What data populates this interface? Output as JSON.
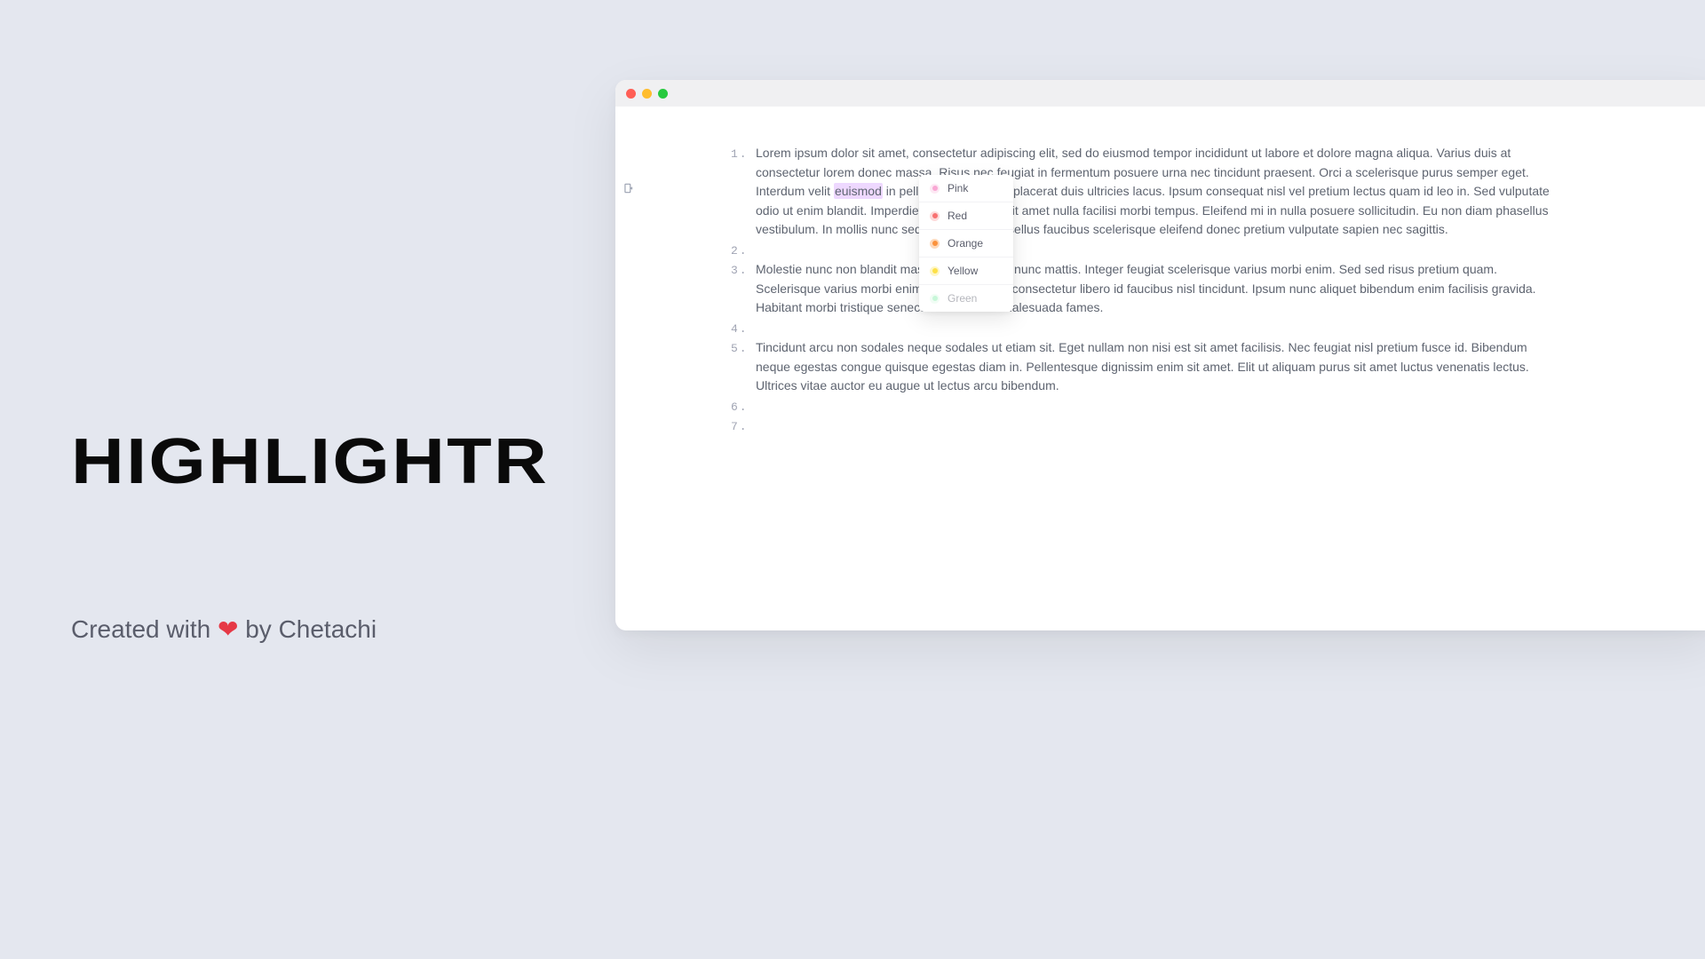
{
  "brand": "HIGHLIGHTR",
  "credit": {
    "prefix": "Created with ",
    "heart": "❤",
    "suffix": " by Chetachi"
  },
  "editor": {
    "highlighted_word": "euismod",
    "lines": [
      {
        "n": "1.",
        "before": "Lorem ipsum dolor sit amet, consectetur adipiscing elit, sed do eiusmod tempor incididunt ut labore et dolore magna aliqua. Varius duis at consectetur lorem donec massa. Risus nec feugiat in fermentum posuere urna nec tincidunt praesent. Orci a scelerisque purus semper eget. Interdum velit ",
        "hl": "euismod",
        "after": " in pellentesque massa placerat duis ultricies lacus. Ipsum consequat nisl vel pretium lectus quam id leo in. Sed vulputate odio ut enim blandit. Imperdiet dui accumsan sit amet nulla facilisi morbi tempus. Eleifend mi in nulla posuere sollicitudin. Eu non diam phasellus vestibulum. In mollis nunc sed id semper. Phasellus faucibus scelerisque eleifend donec pretium vulputate sapien nec sagittis."
      },
      {
        "n": "2.",
        "before": "",
        "hl": "",
        "after": ""
      },
      {
        "n": "3.",
        "before": "Molestie nunc non blandit massa enim nec dui nunc mattis. Integer feugiat scelerisque varius morbi enim. Sed sed risus pretium quam. Scelerisque varius morbi enim nunc. Interdum consectetur libero id faucibus nisl tincidunt. Ipsum nunc aliquet bibendum enim facilisis gravida. Habitant morbi tristique senectus et netus et malesuada fames.",
        "hl": "",
        "after": ""
      },
      {
        "n": "4.",
        "before": "",
        "hl": "",
        "after": ""
      },
      {
        "n": "5.",
        "before": "Tincidunt arcu non sodales neque sodales ut etiam sit. Eget nullam non nisi est sit amet facilisis. Nec feugiat nisl pretium fusce id. Bibendum neque egestas congue quisque egestas diam in. Pellentesque dignissim enim sit amet. Elit ut aliquam purus sit amet luctus venenatis lectus. Ultrices vitae auctor eu augue ut lectus arcu bibendum.",
        "hl": "",
        "after": ""
      },
      {
        "n": "6.",
        "before": "",
        "hl": "",
        "after": ""
      },
      {
        "n": "7.",
        "before": "",
        "hl": "",
        "after": ""
      }
    ]
  },
  "color_menu": [
    {
      "label": "Pink",
      "swatch_class": "swatch-pink",
      "selected": false
    },
    {
      "label": "Red",
      "swatch_class": "swatch-red",
      "selected": false
    },
    {
      "label": "Orange",
      "swatch_class": "swatch-orange",
      "selected": true
    },
    {
      "label": "Yellow",
      "swatch_class": "swatch-yellow",
      "selected": false
    },
    {
      "label": "Green",
      "swatch_class": "swatch-green",
      "selected": false
    }
  ]
}
